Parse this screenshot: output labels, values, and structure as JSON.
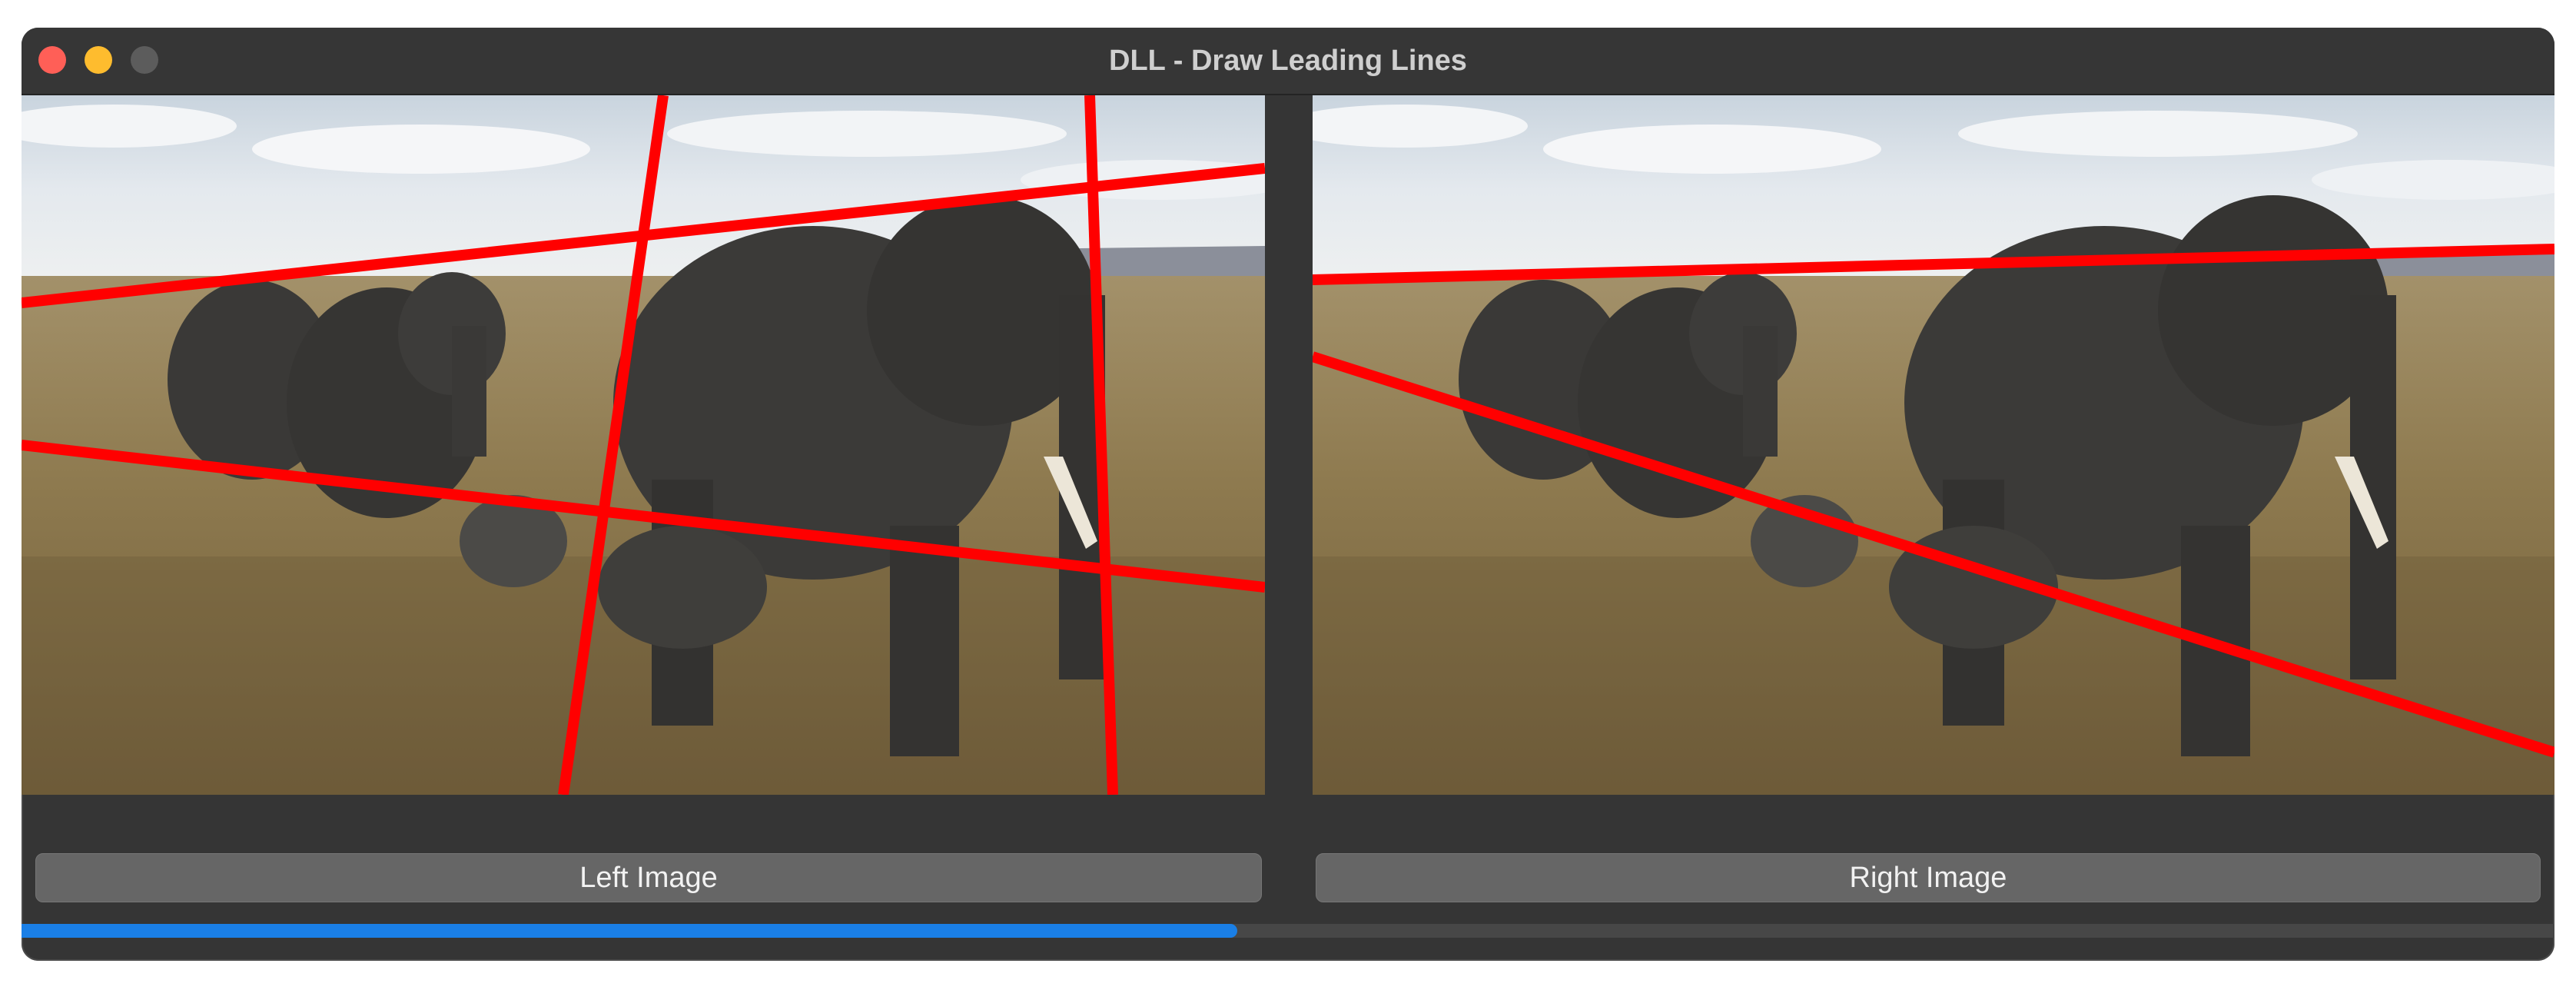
{
  "window": {
    "title": "DLL - Draw Leading Lines"
  },
  "buttons": {
    "left_label": "Left Image",
    "right_label": "Right Image"
  },
  "progress": {
    "value_percent": 48
  },
  "colors": {
    "line": "#ff0000",
    "accent": "#1a7fe6",
    "window_bg": "#353535"
  }
}
